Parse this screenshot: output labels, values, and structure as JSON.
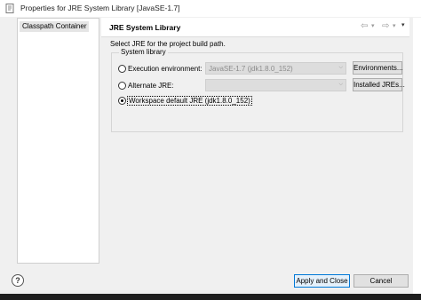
{
  "window": {
    "title": "Properties for JRE System Library [JavaSE-1.7]",
    "icon": "properties-page-icon"
  },
  "tree": {
    "items": [
      {
        "label": "Classpath Container",
        "selected": true
      }
    ]
  },
  "page": {
    "title": "JRE System Library",
    "nav": {
      "back": "⇦",
      "back_dropdown": "▾",
      "forward": "⇨",
      "forward_dropdown": "▾",
      "menu": "▾"
    },
    "description": "Select JRE for the project build path."
  },
  "group": {
    "label": "System library",
    "options": [
      {
        "label": "Execution environment:",
        "checked": false,
        "combo_value": "JavaSE-1.7 (jdk1.8.0_152)",
        "button": "Environments..."
      },
      {
        "label": "Alternate JRE:",
        "checked": false,
        "combo_value": "",
        "button": "Installed JREs..."
      },
      {
        "label": "Workspace default JRE (jdk1.8.0_152)",
        "checked": true
      }
    ]
  },
  "footer": {
    "help": "?",
    "apply_close": "Apply and Close",
    "cancel": "Cancel"
  },
  "colors": {
    "accent": "#0078d7",
    "panel": "#f0f0f0",
    "disabled_field": "#dddddd"
  }
}
